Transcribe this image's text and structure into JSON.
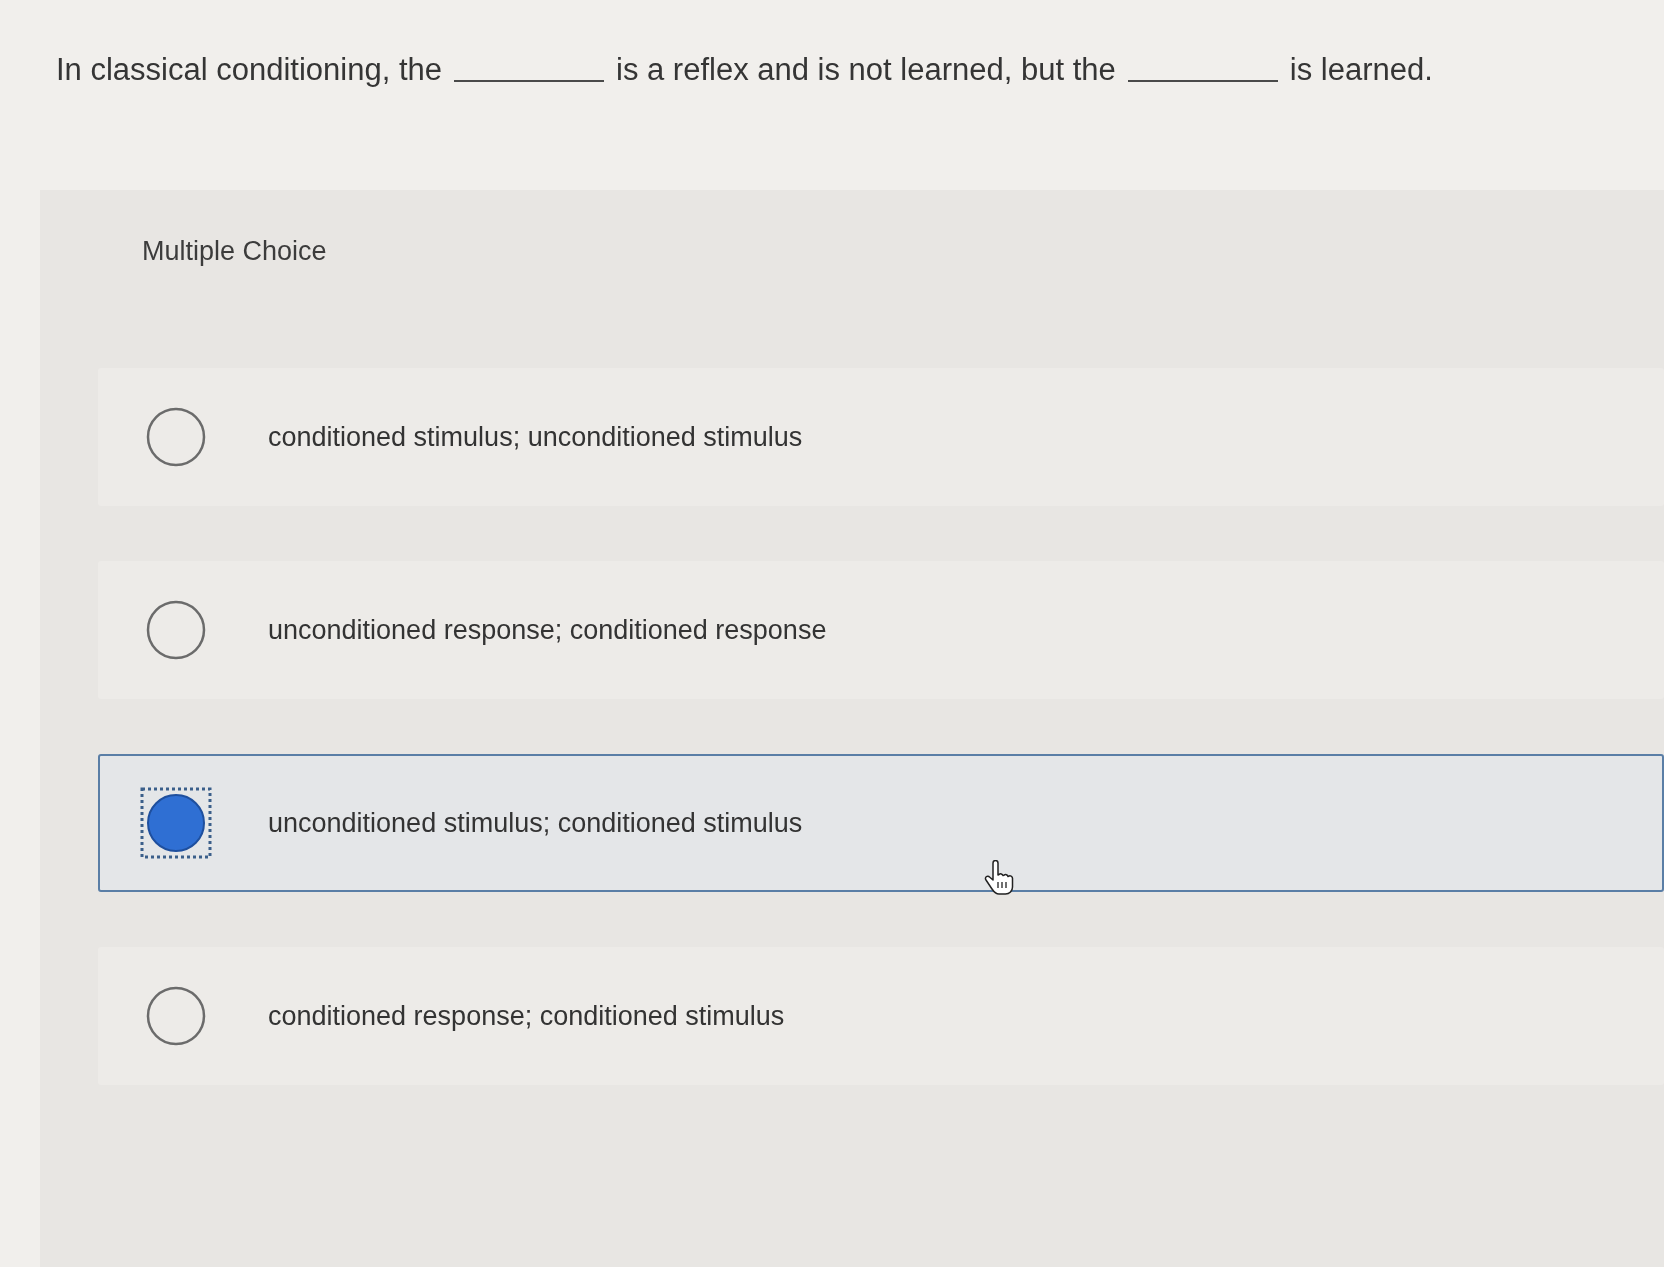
{
  "question": {
    "segments": [
      {
        "kind": "text",
        "text": "In classical conditioning, the"
      },
      {
        "kind": "blank"
      },
      {
        "kind": "text",
        "text": "is a reflex and is not learned, but the"
      },
      {
        "kind": "blank"
      },
      {
        "kind": "text",
        "text": "is learned."
      }
    ]
  },
  "section_title": "Multiple Choice",
  "options": [
    {
      "text": "conditioned stimulus; unconditioned stimulus",
      "selected": false
    },
    {
      "text": "unconditioned response; conditioned response",
      "selected": false
    },
    {
      "text": "unconditioned stimulus; conditioned stimulus",
      "selected": true
    },
    {
      "text": "conditioned response; conditioned stimulus",
      "selected": false
    }
  ]
}
